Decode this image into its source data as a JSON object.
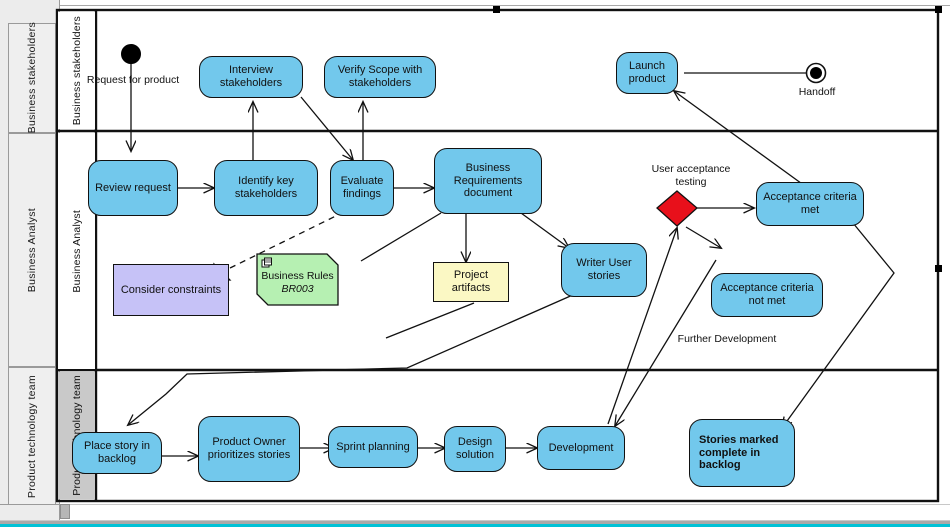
{
  "window": {
    "scrollbar": "horizontal-scrollbar",
    "accent_color": "#00c2d6"
  },
  "colors": {
    "activity_fill": "#72c8ec",
    "decision_fill": "#e8101b",
    "note_purple": "#c6c2f7",
    "note_green": "#b6f0b2",
    "note_yellow": "#fbf8c4",
    "stroke": "#111111",
    "lane_header_fill": "#efefef"
  },
  "row_headers": [
    {
      "label": "Business stakeholders"
    },
    {
      "label": "Business Analyst"
    },
    {
      "label": "Product technology team"
    }
  ],
  "lanes": [
    {
      "label": "Business stakeholders"
    },
    {
      "label": "Business Analyst"
    },
    {
      "label": "Product technology team"
    }
  ],
  "diagram": {
    "type": "uml-activity-swimlane",
    "initial_node": {
      "label": "Request for product"
    },
    "final_node": {
      "label": "Handoff"
    },
    "decision_node": {
      "label": "User acceptance testing"
    },
    "edge_labels": [
      {
        "label": "Further Development"
      }
    ],
    "activities": [
      {
        "id": "interview",
        "label": "Interview stakeholders",
        "lane": "Business stakeholders"
      },
      {
        "id": "verify",
        "label": "Verify Scope with stakeholders",
        "lane": "Business stakeholders"
      },
      {
        "id": "launch",
        "label": "Launch product",
        "lane": "Business stakeholders"
      },
      {
        "id": "review",
        "label": "Review request",
        "lane": "Business Analyst"
      },
      {
        "id": "identify",
        "label": "Identify key stakeholders",
        "lane": "Business Analyst"
      },
      {
        "id": "evaluate",
        "label": "Evaluate findings",
        "lane": "Business Analyst"
      },
      {
        "id": "brd",
        "label": "Business Requirements document",
        "lane": "Business Analyst"
      },
      {
        "id": "writer",
        "label": "Writer User stories",
        "lane": "Business Analyst"
      },
      {
        "id": "accept_met",
        "label": "Acceptance criteria met",
        "lane": "Business Analyst"
      },
      {
        "id": "accept_not_met",
        "label": "Acceptance criteria not met",
        "lane": "Business Analyst"
      },
      {
        "id": "place_story",
        "label": "Place story in backlog",
        "lane": "Product technology team"
      },
      {
        "id": "po_prioritizes",
        "label": "Product Owner prioritizes stories",
        "lane": "Product technology team"
      },
      {
        "id": "sprint",
        "label": "Sprint planning",
        "lane": "Product technology team"
      },
      {
        "id": "design",
        "label": "Design solution",
        "lane": "Product technology team"
      },
      {
        "id": "development",
        "label": "Development",
        "lane": "Product technology team"
      },
      {
        "id": "stories_done",
        "label": "Stories marked complete in backlog",
        "lane": "Product technology team"
      }
    ],
    "notes": [
      {
        "id": "constraints",
        "kind": "constraint-note",
        "label": "Consider constraints"
      },
      {
        "id": "business_rules",
        "kind": "business-rule-note",
        "label": "Business Rules",
        "sublabel": "BR003"
      },
      {
        "id": "artifacts",
        "kind": "artifact-note",
        "label": "Project artifacts"
      }
    ]
  }
}
